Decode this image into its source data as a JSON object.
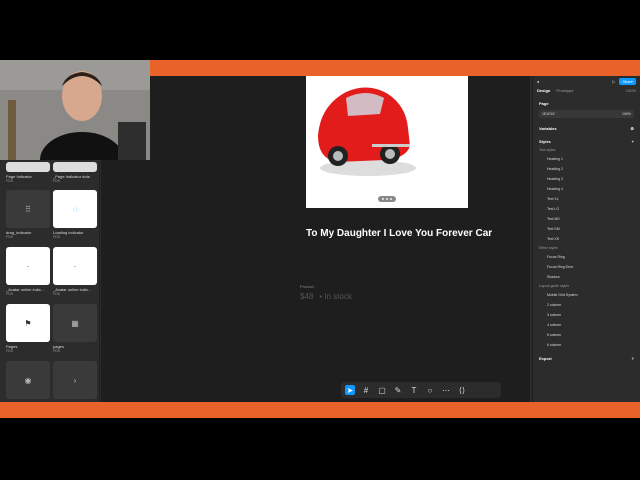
{
  "canvas": {
    "product_title": "To My Daughter I Love You Forever Car",
    "price_label": "Product",
    "price_value": "$48",
    "stock_text": "• In stock"
  },
  "assets": [
    {
      "name": "Page Indicator",
      "sub": "FDS"
    },
    {
      "name": "_Page Indicator dots",
      "sub": "FDS"
    },
    {
      "name": "drag_indicator",
      "sub": "FDS"
    },
    {
      "name": "Loading indicator",
      "sub": "FDS"
    },
    {
      "name": "_Avatar online indic...",
      "sub": "FDS"
    },
    {
      "name": "_Avatar online indic...",
      "sub": "FDS"
    },
    {
      "name": "Pages",
      "sub": "FDS"
    },
    {
      "name": "pages",
      "sub": "FDS"
    }
  ],
  "right_panel": {
    "share": "Share",
    "zoom": "100%",
    "tabs": [
      "Design",
      "Prototype"
    ],
    "page_label": "Page",
    "page_color": "1E1E1E",
    "page_opacity": "100",
    "page_opacity_unit": "%",
    "variables": "Variables",
    "styles": "Styles",
    "text_styles_label": "Text styles",
    "text_styles": [
      "Heading 1",
      "Heading 2",
      "Heading 3",
      "Heading 4",
      "Text XL",
      "Text LG",
      "Text MD",
      "Text SM",
      "Text XS"
    ],
    "effect_styles_label": "Effect styles",
    "effect_styles": [
      "Focus Ring",
      "Focus Ring Error",
      "Shadow"
    ],
    "layout_styles_label": "Layout guide styles",
    "layout_styles": [
      "Mobile Grid System",
      "2 column",
      "3 column",
      "4 column",
      "5 column",
      "6 column"
    ],
    "export": "Export"
  }
}
